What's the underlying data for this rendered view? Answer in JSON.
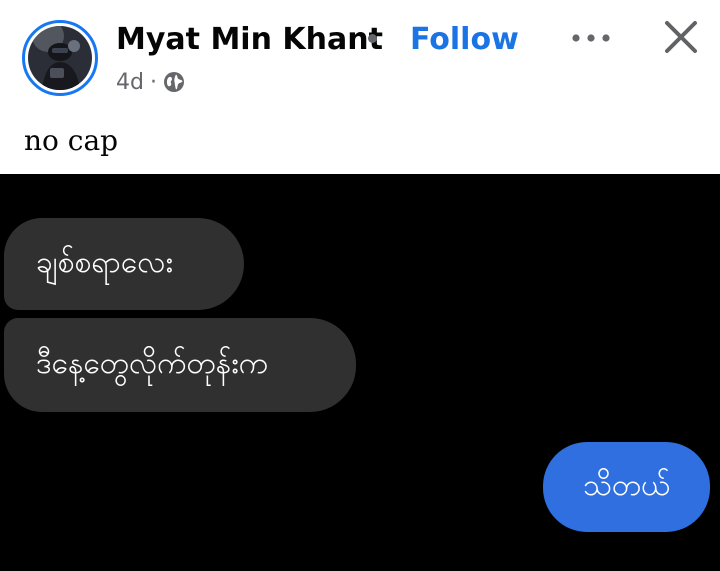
{
  "post": {
    "author": "Myat Min Khant",
    "follow_label": "Follow",
    "timestamp": "4d",
    "meta_separator": "·",
    "audience_icon": "globe-icon",
    "more_icon": "ellipsis-icon",
    "close_icon": "close-icon",
    "caption": "no cap"
  },
  "chat": {
    "messages": [
      {
        "direction": "incoming",
        "text": "ချစ်စရာလေး"
      },
      {
        "direction": "incoming",
        "text": "ဒီနေ့တွေလိုက်တုန်းက"
      },
      {
        "direction": "outgoing",
        "text": "သိတယ်"
      }
    ]
  },
  "colors": {
    "link": "#1b74e4",
    "avatar_ring": "#1877f2",
    "secondary_text": "#65676b",
    "incoming_bubble": "#303030",
    "outgoing_bubble": "#2f6fe0",
    "photo_background": "#000000"
  }
}
